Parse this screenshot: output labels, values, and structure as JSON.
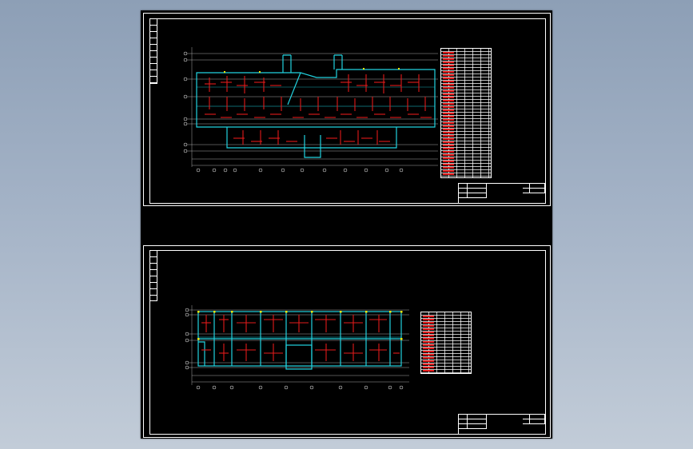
{
  "viewport": {
    "background_gradient": [
      "#8d9fb6",
      "#c2ccd8"
    ],
    "drawing_background": "#000000"
  },
  "colors": {
    "wall": "#22d3e0",
    "rebar": "#e21b1b",
    "line": "#ffffff",
    "column": "#f2e600"
  },
  "sheets": [
    {
      "id": "sheet-1",
      "legend_title": "",
      "legend_rows": 38,
      "title_block": {
        "drawing_name": "",
        "scale": "",
        "sheet_no": ""
      }
    },
    {
      "id": "sheet-2",
      "legend_title": "",
      "legend_rows": 22,
      "title_block": {
        "drawing_name": "",
        "scale": "",
        "sheet_no": ""
      }
    }
  ]
}
